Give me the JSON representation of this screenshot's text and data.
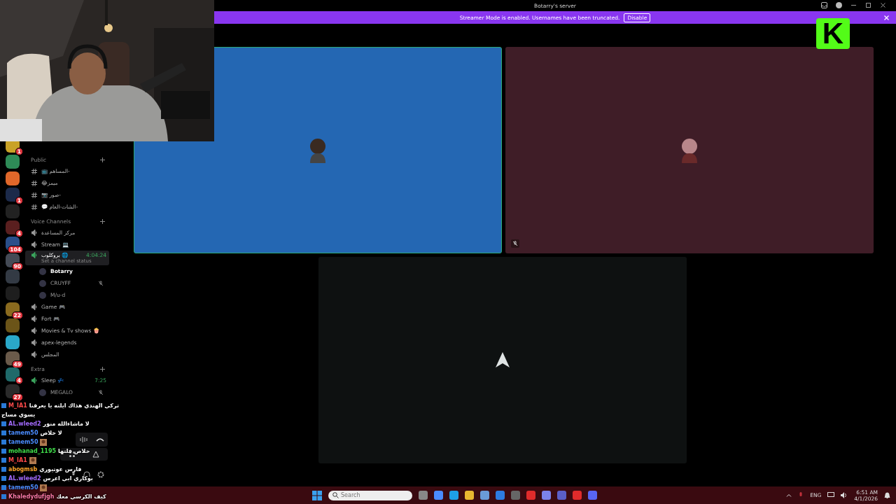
{
  "window": {
    "title": "Botarry's server"
  },
  "banner": {
    "text": "Streamer Mode is enabled. Usernames have been truncated.",
    "button": "Disable"
  },
  "servers": [
    {
      "color": "#c9a227",
      "badge": "1"
    },
    {
      "color": "#2e8b57"
    },
    {
      "color": "#e0672a"
    },
    {
      "color": "#1c2a4a",
      "badge": "1"
    },
    {
      "color": "#222222"
    },
    {
      "color": "#5a1f1f",
      "badge": "4"
    },
    {
      "color": "#2a4f8a",
      "badge": "104"
    },
    {
      "color": "#444a55",
      "badge": "90"
    },
    {
      "color": "#333a44"
    },
    {
      "color": "#1e1e1e"
    },
    {
      "color": "#8a6a1e",
      "badge": "22"
    },
    {
      "color": "#6b5418"
    },
    {
      "color": "#2aa8c9"
    },
    {
      "color": "#6a5a4a",
      "badge": "49"
    },
    {
      "color": "#1f6a6a",
      "badge": "4"
    },
    {
      "color": "#2a2a2a",
      "badge": "27"
    }
  ],
  "channels": [
    {
      "kind": "category",
      "name": "Public"
    },
    {
      "kind": "text",
      "name": "-المساهم 📺"
    },
    {
      "kind": "text",
      "name": "ميمز😂"
    },
    {
      "kind": "text",
      "name": "-صور 📷"
    },
    {
      "kind": "text",
      "name": "-الشات-العام 💬"
    },
    {
      "kind": "category",
      "name": "Voice Channels"
    },
    {
      "kind": "voice",
      "name": "مركز المساعدة",
      "connected": false,
      "selected": false
    },
    {
      "kind": "voice",
      "name": "Stream 💻",
      "connected": false,
      "selected": false
    },
    {
      "kind": "voice",
      "name": "بروكلوب 🌐",
      "connected": true,
      "selected": true,
      "time": "4:04:24",
      "status": "Set a channel status"
    },
    {
      "kind": "member",
      "name": "Botarry",
      "active": true,
      "muted": false
    },
    {
      "kind": "member",
      "name": "CRUYFF",
      "active": false,
      "muted": true
    },
    {
      "kind": "member",
      "name": "M/u-d",
      "active": false,
      "muted": false
    },
    {
      "kind": "voice",
      "name": "Game 🎮",
      "connected": false,
      "selected": false
    },
    {
      "kind": "voice",
      "name": "Fort 🎮",
      "connected": false,
      "selected": false
    },
    {
      "kind": "voice",
      "name": "Movies & Tv shows 🍿",
      "connected": false,
      "selected": false
    },
    {
      "kind": "voice",
      "name": "apex-legends",
      "connected": false,
      "selected": false
    },
    {
      "kind": "voice",
      "name": "المجلس",
      "connected": false,
      "selected": false
    },
    {
      "kind": "category",
      "name": "Extra"
    },
    {
      "kind": "voice",
      "name": "Sleep 💤",
      "connected": true,
      "selected": false,
      "time": "7:25"
    },
    {
      "kind": "member",
      "name": "MEGALO",
      "active": false,
      "muted": true
    }
  ],
  "tiles": [
    {
      "color": "#2467b3",
      "speaking": true,
      "muted": false
    },
    {
      "color": "#3f1d27",
      "speaking": false,
      "muted": true
    },
    {
      "color": "#0e1111",
      "speaking": false,
      "muted": false
    }
  ],
  "chat": [
    {
      "kind": "text",
      "user": "M_IA1",
      "color": "#ff4a4a",
      "message": "تركي الهندي هذاك ايلته يا يعرفنا"
    },
    {
      "kind": "continued",
      "message": "يسوي مساج"
    },
    {
      "kind": "text",
      "user": "AL.wleed2",
      "color": "#a36bff",
      "message": "لا ماشاءالله منور"
    },
    {
      "kind": "text",
      "user": "tamem50",
      "color": "#4a8cff",
      "message": "لا خلاص"
    },
    {
      "kind": "emote",
      "user": "tamem50",
      "color": "#4a8cff"
    },
    {
      "kind": "text",
      "user": "mohanad_1195",
      "color": "#3fdc4a",
      "message": "خلاص فلتها"
    },
    {
      "kind": "emote",
      "user": "M_IA1",
      "color": "#ff4a4a"
    },
    {
      "kind": "text",
      "user": "abogmsb",
      "color": "#ffa62b",
      "message": "فارس عوتيوري"
    },
    {
      "kind": "text",
      "user": "AL.wleed2",
      "color": "#a36bff",
      "message": "بوكاري ابي اعرس"
    },
    {
      "kind": "emote",
      "user": "tamem50",
      "color": "#4a8cff"
    },
    {
      "kind": "text",
      "user": "Khaledydufjgh",
      "color": "#ff7aa8",
      "message": "كيف الكرسي معك"
    }
  ],
  "logo": {
    "text": "K"
  },
  "taskbar": {
    "search": {
      "placeholder": "Search"
    },
    "language": "ENG",
    "time": "6:51 AM",
    "date": "4/1/2026"
  }
}
